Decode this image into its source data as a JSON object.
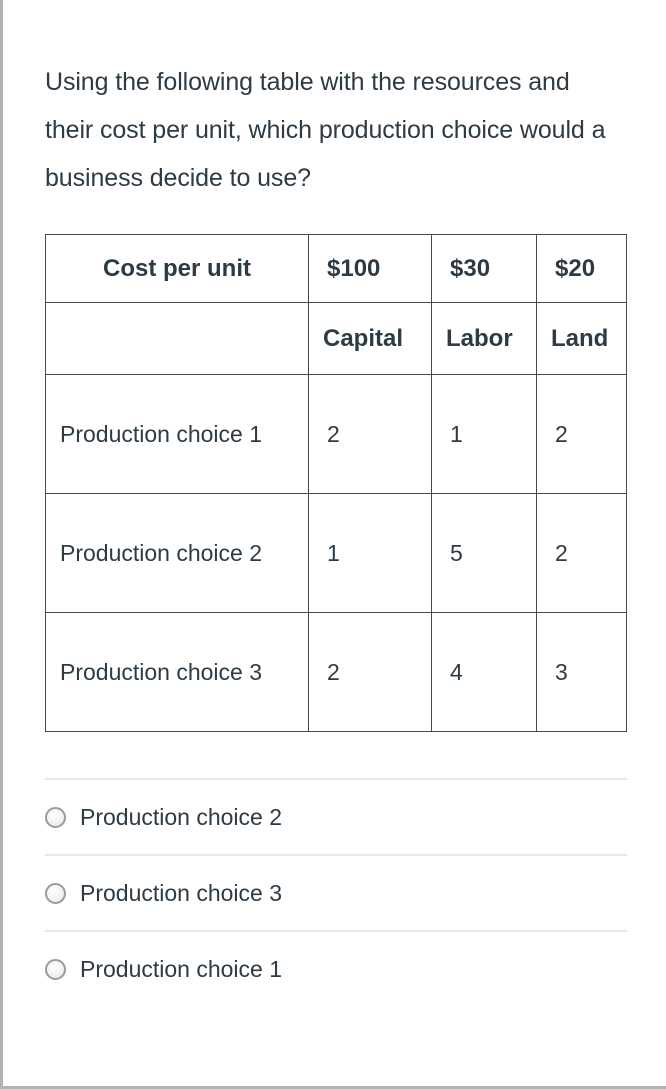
{
  "question": {
    "text": "Using the following table with the resources and their cost per unit, which production choice would a business decide to use?"
  },
  "table": {
    "cost_row": {
      "label": "Cost per unit",
      "values": [
        "$100",
        "$30",
        "$20"
      ]
    },
    "resource_row": {
      "label": "",
      "values": [
        "Capital",
        "Labor",
        "Land"
      ]
    },
    "rows": [
      {
        "label": "Production choice 1",
        "values": [
          "2",
          "1",
          "2"
        ]
      },
      {
        "label": "Production choice 2",
        "values": [
          "1",
          "5",
          "2"
        ]
      },
      {
        "label": "Production choice 3",
        "values": [
          "2",
          "4",
          "3"
        ]
      }
    ]
  },
  "answers": {
    "options": [
      {
        "label": "Production choice 2",
        "selected": false
      },
      {
        "label": "Production choice 3",
        "selected": false
      },
      {
        "label": "Production choice 1",
        "selected": false
      }
    ]
  },
  "colors": {
    "text": "#2d3b45",
    "table_border": "#4a4a4a",
    "option_divider": "#e8e8e9",
    "page_border": "#b3b3b3",
    "radio_border": "#9b9b9b"
  }
}
